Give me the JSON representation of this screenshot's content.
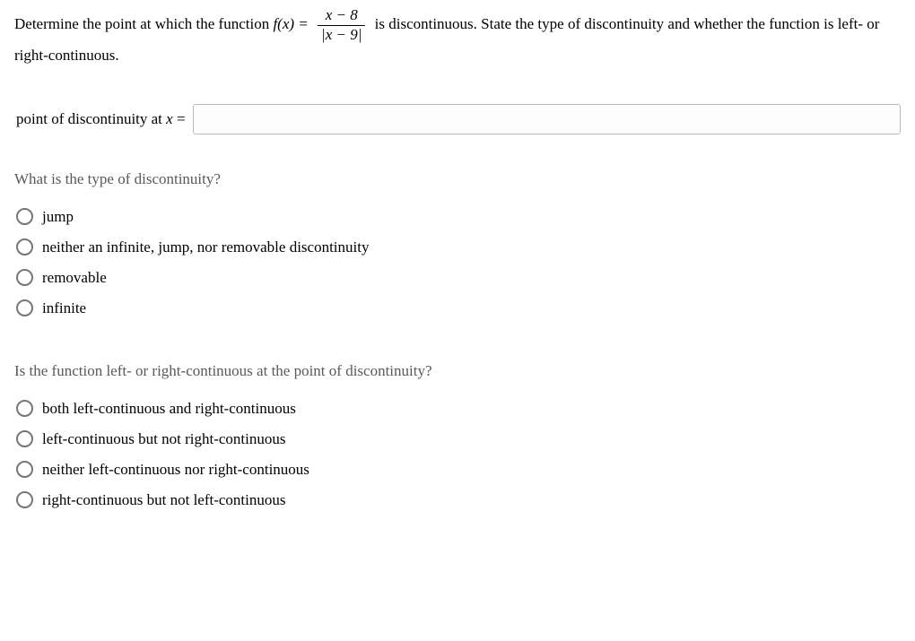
{
  "question": {
    "pre": "Determine the point at which the function ",
    "func_lhs": "f(x) = ",
    "frac_num": "x − 8",
    "frac_den": "|x − 9|",
    "post": " is discontinuous. State the type of discontinuity and whether the function is left- or right-continuous."
  },
  "answer": {
    "label_pre": "point of discontinuity at ",
    "label_var": "x",
    "label_post": " = ",
    "value": ""
  },
  "q2": {
    "prompt": "What is the type of discontinuity?",
    "options": [
      "jump",
      "neither an infinite, jump, nor removable discontinuity",
      "removable",
      "infinite"
    ]
  },
  "q3": {
    "prompt": "Is the function left- or right-continuous at the point of discontinuity?",
    "options": [
      "both left-continuous and right-continuous",
      "left-continuous but not right-continuous",
      "neither left-continuous nor right-continuous",
      "right-continuous but not left-continuous"
    ]
  }
}
